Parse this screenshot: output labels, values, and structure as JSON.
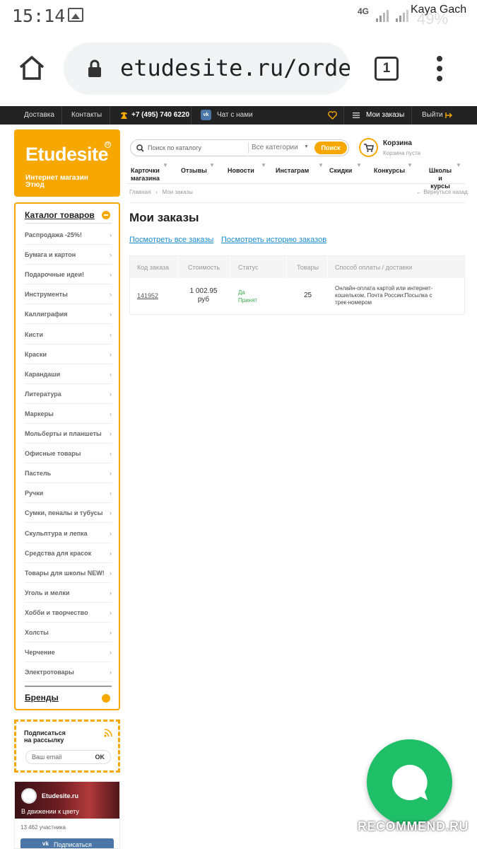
{
  "status_bar": {
    "time": "15:14",
    "network": "4G",
    "owner": "Kaya Gach",
    "battery": "49%"
  },
  "browser": {
    "url": "etudesite.ru/orde",
    "tab_count": "1"
  },
  "top_nav": {
    "delivery": "Доставка",
    "contacts": "Контакты",
    "phone": "+7 (495) 740 6220",
    "chat": "Чат с нами",
    "my_orders": "Мои заказы",
    "logout": "Выйти"
  },
  "logo": {
    "name": "Etudesite",
    "subtitle_line1": "Интернет магазин",
    "subtitle_line2": "Этюд"
  },
  "search": {
    "placeholder": "Поиск по каталогу",
    "category": "Все категории",
    "button": "Поиск"
  },
  "cart": {
    "title": "Корзина",
    "status": "Корзина пуста"
  },
  "main_menu": [
    {
      "label1": "Карточки",
      "label2": "магазина"
    },
    {
      "label1": "Отзывы",
      "label2": ""
    },
    {
      "label1": "Новости",
      "label2": ""
    },
    {
      "label1": "Инстаграм",
      "label2": ""
    },
    {
      "label1": "Скидки",
      "label2": ""
    },
    {
      "label1": "Конкурсы",
      "label2": ""
    },
    {
      "label1": "Школы и",
      "label2": "курсы"
    }
  ],
  "breadcrumb": {
    "home": "Главная",
    "sep": "›",
    "current": "Мои заказы",
    "back": "← Вернуться назад"
  },
  "page_title": "Мои заказы",
  "links": {
    "all_orders": "Посмотреть все заказы",
    "history": "Посмотреть историю заказов"
  },
  "orders_table": {
    "headers": [
      "Код заказа",
      "Стоимость",
      "Статус",
      "Товары",
      "Способ оплаты / доставки"
    ],
    "rows": [
      {
        "code": "141952",
        "cost_line1": "1 002.95",
        "cost_line2": "руб",
        "status_line1": "Да",
        "status_line2": "Принят",
        "items": "25",
        "method_line1": "Онлайн-оплата картой или интернет-",
        "method_line2": "кошельком, Почта России:Посылка с",
        "method_line3": "трек-номером"
      }
    ]
  },
  "catalog": {
    "title": "Каталог товаров",
    "items": [
      "Распродажа -25%!",
      "Бумага и картон",
      "Подарочные идеи!",
      "Инструменты",
      "Каллиграфия",
      "Кисти",
      "Краски",
      "Карандаши",
      "Литература",
      "Маркеры",
      "Мольберты и планшеты",
      "Офисные товары",
      "Пастель",
      "Ручки",
      "Сумки, пеналы и тубусы",
      "Скульптура и лепка",
      "Средства для красок",
      "Товары для школы NEW!",
      "Уголь и мелки",
      "Хобби и творчество",
      "Холсты",
      "Черчение",
      "Электротовары"
    ],
    "chevron": "›",
    "brands": "Бренды"
  },
  "newsletter": {
    "title_line1": "Подписаться",
    "title_line2": "на рассылку",
    "placeholder": "Ваш email",
    "button": "OK"
  },
  "vk_widget": {
    "name": "Etudesite.ru",
    "tagline": "В движении к цвету",
    "members": "13 462 участника",
    "subscribe": "Подписаться"
  },
  "watermark": "RECOMMEND.RU",
  "colors": {
    "accent": "#f7a800",
    "link": "#1a8bd0",
    "status_green": "#3aa84a",
    "fab": "#1fbf68",
    "topnav_bg": "#232323",
    "vk_blue": "#4a76a8"
  }
}
